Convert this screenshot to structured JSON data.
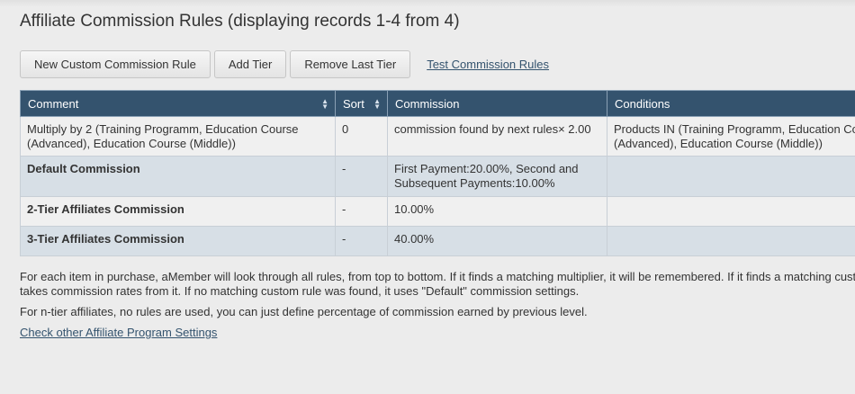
{
  "page": {
    "title": "Affiliate Commission Rules (displaying records 1-4 from 4)"
  },
  "toolbar": {
    "new_rule_label": "New Custom Commission Rule",
    "add_tier_label": "Add Tier",
    "remove_tier_label": "Remove Last Tier",
    "test_link_label": "Test Commission Rules"
  },
  "grid": {
    "columns": [
      "Comment",
      "Sort",
      "Commission",
      "Conditions"
    ],
    "rows": [
      {
        "comment": "Multiply by 2 (Training Programm, Education Course (Advanced), Education Course (Middle))",
        "sort": "0",
        "commission": "commission found by next rules× 2.00",
        "conditions": "Products IN (Training Programm, Education Course (Advanced), Education Course (Middle))"
      },
      {
        "comment": "Default Commission",
        "sort": "-",
        "commission": "First Payment:20.00%, Second and Subsequent Payments:10.00%",
        "conditions": ""
      },
      {
        "comment": "2-Tier Affiliates Commission",
        "sort": "-",
        "commission": "10.00%",
        "conditions": ""
      },
      {
        "comment": "3-Tier Affiliates Commission",
        "sort": "-",
        "commission": "40.00%",
        "conditions": ""
      }
    ]
  },
  "notes": {
    "p1": "For each item in purchase, aMember will look through all rules, from top to bottom. If it finds a matching multiplier, it will be remembered. If it finds a matching custom rule, it takes commission rates from it. If no matching custom rule was found, it uses \"Default\" commission settings.",
    "p2": "For n-tier affiliates, no rules are used, you can just define percentage of commission earned by previous level.",
    "settings_link": "Check other Affiliate Program Settings"
  },
  "colors": {
    "header_bg": "#34536e",
    "page_bg": "#ececec",
    "row_alt_bg": "#d7dfe6",
    "link": "#34536e"
  },
  "icons": {
    "sort": "sort-arrows-icon"
  }
}
